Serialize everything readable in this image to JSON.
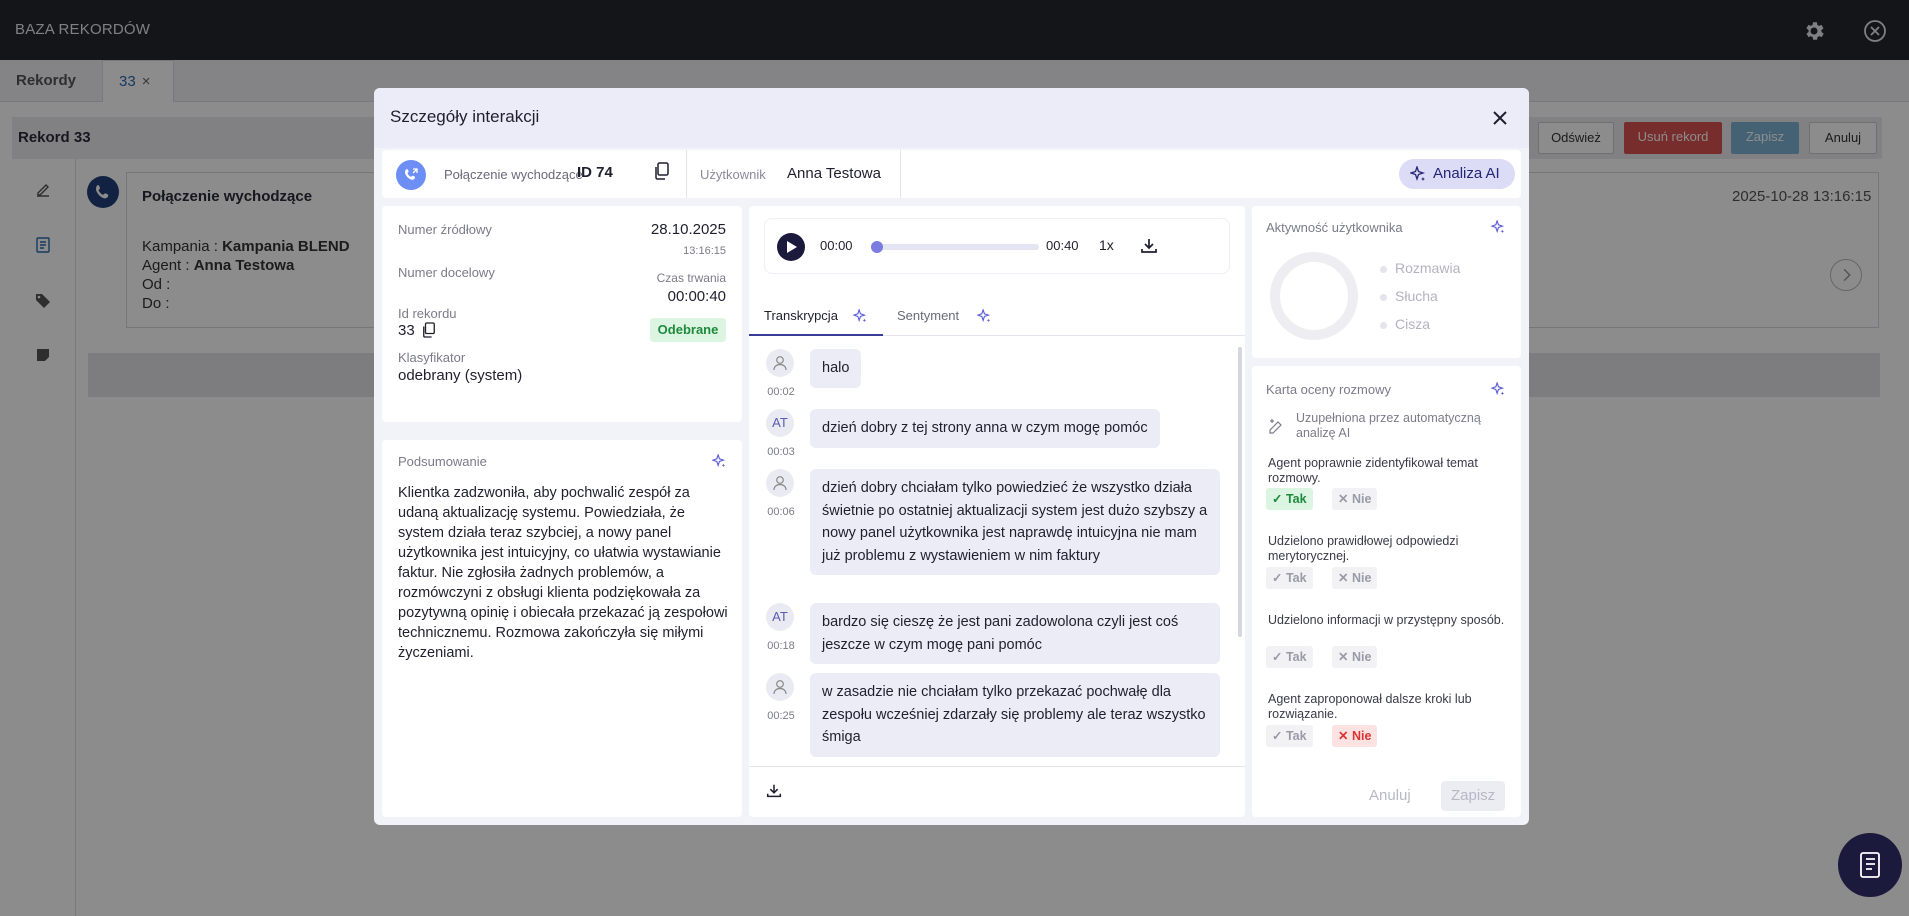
{
  "app": {
    "title": "BAZA REKORDÓW",
    "tabs": [
      {
        "label": "Rekordy"
      },
      {
        "label": "33",
        "close": "×"
      }
    ],
    "record_title": "Rekord 33",
    "buttons": {
      "refresh": "Odśwież",
      "delete": "Usuń rekord",
      "save": "Zapisz",
      "cancel": "Anuluj"
    },
    "call_card": {
      "title": "Połączenie wychodzące",
      "date": "2025-10-28 13:16:15",
      "campaign_label": "Kampania :",
      "campaign": "Kampania BLEND",
      "agent_label": "Agent :",
      "agent": "Anna Testowa",
      "from_label": "Od :",
      "to_label": "Do :"
    }
  },
  "modal": {
    "title": "Szczegóły interakcji",
    "infobar": {
      "call_type": "Połączenie wychodzące",
      "id": "ID 74",
      "user_label": "Użytkownik",
      "user": "Anna Testowa",
      "ai_button": "Analiza AI"
    },
    "details": {
      "source_label": "Numer źródłowy",
      "date": "28.10.2025",
      "time": "13:16:15",
      "target_label": "Numer docelowy",
      "duration_label": "Czas trwania",
      "duration": "00:00:40",
      "record_id_label": "Id rekordu",
      "record_id": "33",
      "status": "Odebrane",
      "classifier_label": "Klasyfikator",
      "classifier": "odebrany (system)"
    },
    "summary": {
      "title": "Podsumowanie",
      "text": "Klientka zadzwoniła, aby pochwalić zespół za udaną aktualizację systemu. Powiedziała, że system działa teraz szybciej, a nowy panel użytkownika jest intuicyjny, co ułatwia wystawianie faktur. Nie zgłosiła żadnych problemów, a rozmówczyni z obsługi klienta podziękowała za pozytywną opinię i obiecała przekazać ją zespołowi technicznemu. Rozmowa zakończyła się miłymi życzeniami."
    },
    "audio": {
      "current": "00:00",
      "total": "00:40",
      "speed": "1x",
      "progress": 0
    },
    "tabs": [
      {
        "label": "Transkrypcja"
      },
      {
        "label": "Sentyment"
      }
    ],
    "transcript": [
      {
        "speaker": "client",
        "time": "00:02",
        "text": "halo"
      },
      {
        "speaker": "agent",
        "initials": "AT",
        "time": "00:03",
        "text": "dzień dobry z tej strony anna w czym mogę pomóc"
      },
      {
        "speaker": "client",
        "time": "00:06",
        "text": "dzień dobry chciałam tylko powiedzieć że wszystko działa świetnie po ostatniej aktualizacji system jest dużo szybszy a nowy panel użytkownika jest naprawdę intuicyjna nie mam już problemu z wystawieniem w nim faktury"
      },
      {
        "speaker": "agent",
        "initials": "AT",
        "time": "00:18",
        "text": "bardzo się cieszę że jest pani zadowolona czyli jest coś jeszcze w czym mogę pani pomóc"
      },
      {
        "speaker": "client",
        "time": "00:25",
        "text": "w zasadzie nie chciałam tylko przekazać pochwałę dla zespołu wcześniej zdarzały się problemy ale teraz wszystko śmiga"
      }
    ],
    "activity": {
      "title": "Aktywność użytkownika",
      "legend": [
        "Rozmawia",
        "Słucha",
        "Cisza"
      ]
    },
    "scorecard": {
      "title": "Karta oceny rozmowy",
      "note": "Uzupełniona przez automatyczną analizę AI",
      "yes": "Tak",
      "no": "Nie",
      "questions": [
        {
          "text": "Agent poprawnie zidentyfikował temat rozmowy.",
          "answer": "yes"
        },
        {
          "text": "Udzielono prawidłowej odpowiedzi merytorycznej.",
          "answer": "none"
        },
        {
          "text": "Udzielono informacji w przystępny sposób.",
          "answer": "none"
        },
        {
          "text": "Agent zaproponował dalsze kroki lub rozwiązanie.",
          "answer": "no"
        }
      ]
    },
    "footer": {
      "cancel": "Anuluj",
      "save": "Zapisz"
    }
  },
  "colors": {
    "accent": "#6d8ef5",
    "ai": "#252578",
    "yes": "#1e8a3c",
    "no": "#dd3333",
    "delete": "#d9534f"
  }
}
